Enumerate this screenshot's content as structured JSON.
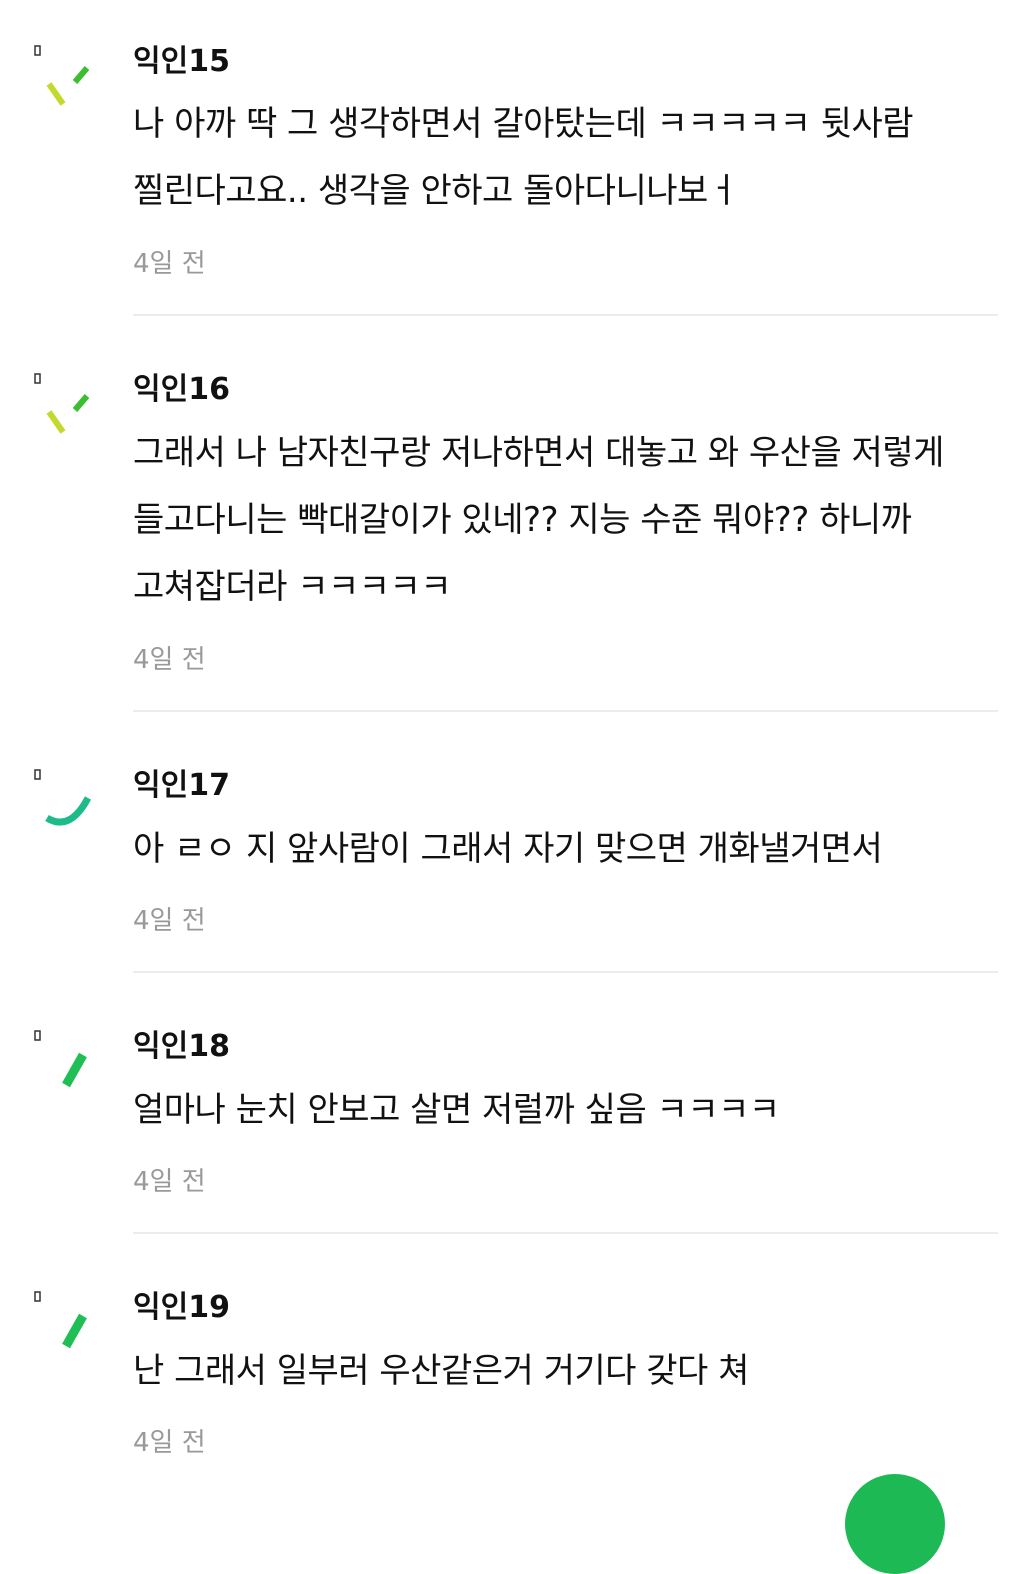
{
  "comments": [
    {
      "author": "익인15",
      "text": "나 아까 딱 그 생각하면서 갈아탔는데 ㅋㅋㅋㅋㅋ 뒷사람 찔린다고요.. 생각을 안하고 돌아다니나보ㅓ",
      "time": "4일 전",
      "avatar": "avatar-dash-yellowgreen-icon"
    },
    {
      "author": "익인16",
      "text": "그래서 나 남자친구랑 저나하면서 대놓고 와 우산을 저렇게 들고다니는 빡대갈이가 있네?? 지능 수준 뭐야?? 하니까 고쳐잡더라 ㅋㅋㅋㅋㅋ",
      "time": "4일 전",
      "avatar": "avatar-dash-yellowgreen-icon"
    },
    {
      "author": "익인17",
      "text": "아 ㄹㅇ 지 앞사람이 그래서 자기 맞으면 개화낼거면서",
      "time": "4일 전",
      "avatar": "avatar-arc-teal-icon"
    },
    {
      "author": "익인18",
      "text": "얼마나 눈치 안보고 살면 저럴까 싶음 ㅋㅋㅋㅋ",
      "time": "4일 전",
      "avatar": "avatar-slash-green-icon"
    },
    {
      "author": "익인19",
      "text": "난 그래서 일부러 우산같은거 거기다 갖다 쳐",
      "time": "4일 전",
      "avatar": "avatar-slash-green-icon"
    }
  ],
  "colors": {
    "timestamp": "#999999",
    "divider": "#ececec",
    "fab": "#1db954"
  },
  "fab": {
    "icon": "write-button-icon"
  }
}
